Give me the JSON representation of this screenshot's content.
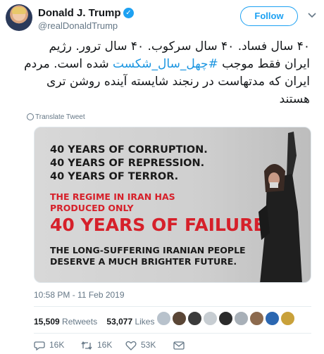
{
  "author": {
    "name": "Donald J. Trump",
    "handle": "@realDonaldTrump",
    "follow_label": "Follow"
  },
  "tweet": {
    "line1": "۴۰ سال فساد. ۴۰ سال سرکوب. ۴۰ سال ترور. رژیم",
    "line2_before": "ایران فقط موجب ",
    "hashtag": "#چهل_سال_شکست",
    "line2_after": " شده است. مردم",
    "line3": "ایران که مدتهاست در رنجند شایسته آینده روشن تری",
    "line4": "هستند",
    "translate_label": "Translate Tweet"
  },
  "media": {
    "line1": "40 YEARS OF CORRUPTION.",
    "line2": "40 YEARS OF REPRESSION.",
    "line3": "40 YEARS OF TERROR.",
    "line4": "THE REGIME IN IRAN HAS",
    "line5": "PRODUCED ONLY",
    "line6": "40 YEARS OF FAILURE.",
    "line7": "THE LONG-SUFFERING IRANIAN PEOPLE",
    "line8": "DESERVE A MUCH BRIGHTER FUTURE."
  },
  "meta": {
    "timestamp": "10:58 PM - 11 Feb 2019",
    "retweets_count": "15,509",
    "retweets_label": "Retweets",
    "likes_count": "53,077",
    "likes_label": "Likes"
  },
  "actions": {
    "replies": "16K",
    "retweets": "16K",
    "likes": "53K"
  },
  "colors": {
    "accent": "#1da1f2",
    "alert_red": "#d6202a",
    "muted": "#657786"
  }
}
